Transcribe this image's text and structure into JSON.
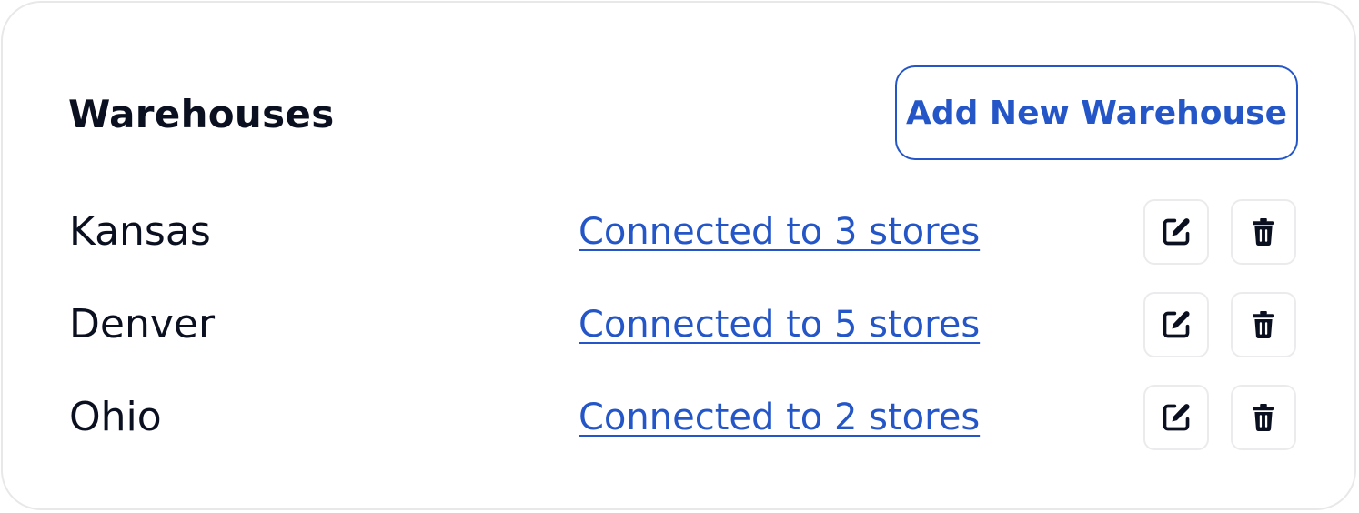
{
  "header": {
    "title": "Warehouses",
    "add_button_label": "Add New Warehouse"
  },
  "warehouses": [
    {
      "name": "Kansas",
      "connection_label": "Connected to 3 stores"
    },
    {
      "name": "Denver",
      "connection_label": "Connected to 5 stores"
    },
    {
      "name": "Ohio",
      "connection_label": "Connected to 2 stores"
    }
  ],
  "icons": {
    "edit": "edit-icon",
    "delete": "trash-icon"
  },
  "colors": {
    "accent": "#2456c8",
    "text": "#0b1020",
    "border": "#e8e8ea"
  }
}
